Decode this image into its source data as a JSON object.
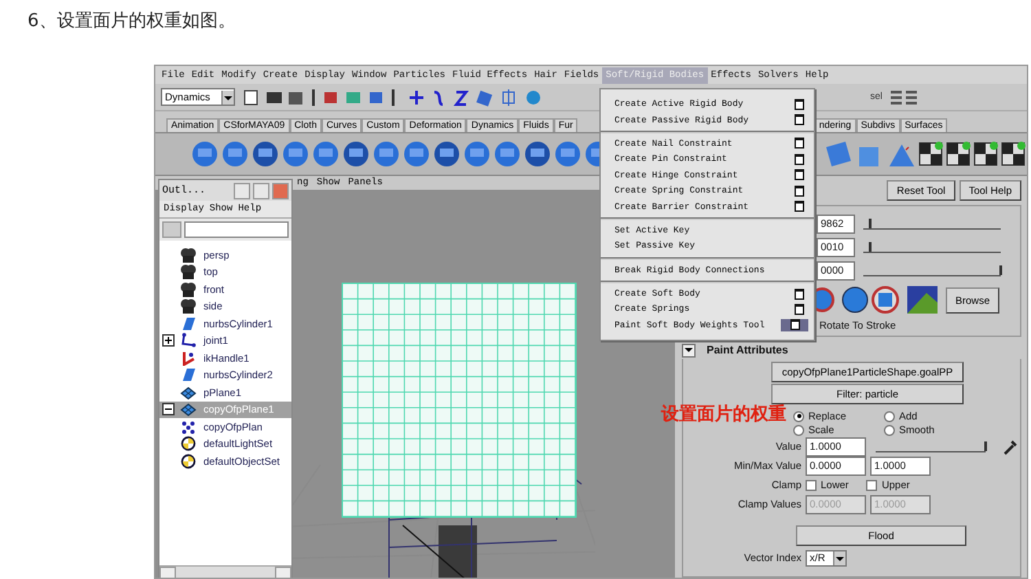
{
  "heading": "6、设置面片的权重如图。",
  "menubar": [
    {
      "label": "File",
      "selected": false
    },
    {
      "label": "Edit",
      "selected": false
    },
    {
      "label": "Modify",
      "selected": false
    },
    {
      "label": "Create",
      "selected": false
    },
    {
      "label": "Display",
      "selected": false
    },
    {
      "label": "Window",
      "selected": false
    },
    {
      "label": "Particles",
      "selected": false
    },
    {
      "label": "Fluid Effects",
      "selected": false
    },
    {
      "label": "Hair",
      "selected": false
    },
    {
      "label": "Fields",
      "selected": false
    },
    {
      "label": "Soft/Rigid Bodies",
      "selected": true
    },
    {
      "label": "Effects",
      "selected": false
    },
    {
      "label": "Solvers",
      "selected": false
    },
    {
      "label": "Help",
      "selected": false
    }
  ],
  "status_line": {
    "mode": "Dynamics",
    "selection_label": "sel"
  },
  "shelf_tabs": {
    "left": [
      "Animation",
      "CSforMAYA09",
      "Cloth",
      "Curves",
      "Custom",
      "Deformation",
      "Dynamics",
      "Fluids",
      "Fur"
    ],
    "right": [
      "ndering",
      "Subdivs",
      "Surfaces"
    ]
  },
  "soft_rigid_menu": {
    "sections": [
      [
        {
          "label": "Create Active Rigid Body",
          "option_box": true,
          "selected": false
        },
        {
          "label": "Create Passive Rigid Body",
          "option_box": true,
          "selected": false
        }
      ],
      [
        {
          "label": "Create Nail Constraint",
          "option_box": true,
          "selected": false
        },
        {
          "label": "Create Pin Constraint",
          "option_box": true,
          "selected": false
        },
        {
          "label": "Create Hinge Constraint",
          "option_box": true,
          "selected": false
        },
        {
          "label": "Create Spring Constraint",
          "option_box": true,
          "selected": false
        },
        {
          "label": "Create Barrier Constraint",
          "option_box": true,
          "selected": false
        }
      ],
      [
        {
          "label": "Set Active Key"
        },
        {
          "label": "Set Passive Key"
        }
      ],
      [
        {
          "label": "Break Rigid Body Connections"
        }
      ],
      [
        {
          "label": "Create Soft Body",
          "option_box": true,
          "selected": false
        },
        {
          "label": "Create Springs",
          "option_box": true,
          "selected": false
        },
        {
          "label": "Paint Soft Body Weights Tool",
          "option_box": true,
          "selected": true
        }
      ]
    ]
  },
  "viewport": {
    "panel_menu": [
      "ng",
      "Show",
      "Panels"
    ]
  },
  "outliner": {
    "title": "Outl...",
    "menu": [
      "Display",
      "Show",
      "Help"
    ],
    "items": [
      {
        "label": "persp",
        "kind": "camera",
        "selected": false
      },
      {
        "label": "top",
        "kind": "camera",
        "selected": false
      },
      {
        "label": "front",
        "kind": "camera",
        "selected": false
      },
      {
        "label": "side",
        "kind": "camera",
        "selected": false
      },
      {
        "label": "nurbsCylinder1",
        "kind": "nurbs",
        "selected": false
      },
      {
        "label": "joint1",
        "kind": "joint",
        "selected": false,
        "expanded": false
      },
      {
        "label": "ikHandle1",
        "kind": "ik",
        "selected": false
      },
      {
        "label": "nurbsCylinder2",
        "kind": "nurbs",
        "selected": false
      },
      {
        "label": "pPlane1",
        "kind": "plane",
        "selected": false
      },
      {
        "label": "copyOfpPlane1",
        "kind": "plane",
        "selected": true,
        "expanded": true,
        "children": [
          {
            "label": "copyOfpPlan",
            "kind": "particle",
            "selected": false
          }
        ]
      },
      {
        "label": "defaultLightSet",
        "kind": "set",
        "selected": false
      },
      {
        "label": "defaultObjectSet",
        "kind": "set",
        "selected": false
      }
    ]
  },
  "tool_settings": {
    "buttons": [
      "Reset Tool",
      "Tool Help"
    ],
    "sliders": [
      {
        "value": "9862",
        "level": 0.05
      },
      {
        "value": "0010",
        "level": 0.05
      },
      {
        "value": "0000",
        "level": 1
      }
    ],
    "browse": "Browse",
    "rotate_to_stroke": "Rotate To Stroke",
    "paint_attributes": {
      "title": "Paint Attributes",
      "attribute_button": "copyOfpPlane1ParticleShape.goalPP",
      "filter_button": "Filter: particle",
      "operations": [
        {
          "label": "Replace",
          "selected": true
        },
        {
          "label": "Add",
          "selected": false
        },
        {
          "label": "Scale",
          "selected": false
        },
        {
          "label": "Smooth",
          "selected": false
        }
      ],
      "value": {
        "label": "Value",
        "value": "1.0000",
        "level": 1
      },
      "min_max": {
        "label": "Min/Max Value",
        "min": "0.0000",
        "max": "1.0000"
      },
      "clamp": {
        "label": "Clamp",
        "options": [
          {
            "label": "Lower",
            "checked": false
          },
          {
            "label": "Upper",
            "checked": false
          }
        ]
      },
      "clamp_values": {
        "label": "Clamp Values",
        "min": "0.0000",
        "max": "1.0000",
        "disabled": true
      },
      "flood": "Flood",
      "vector_index": {
        "label": "Vector Index",
        "value": "x/R"
      }
    }
  },
  "annotation": "设置面片的权重"
}
